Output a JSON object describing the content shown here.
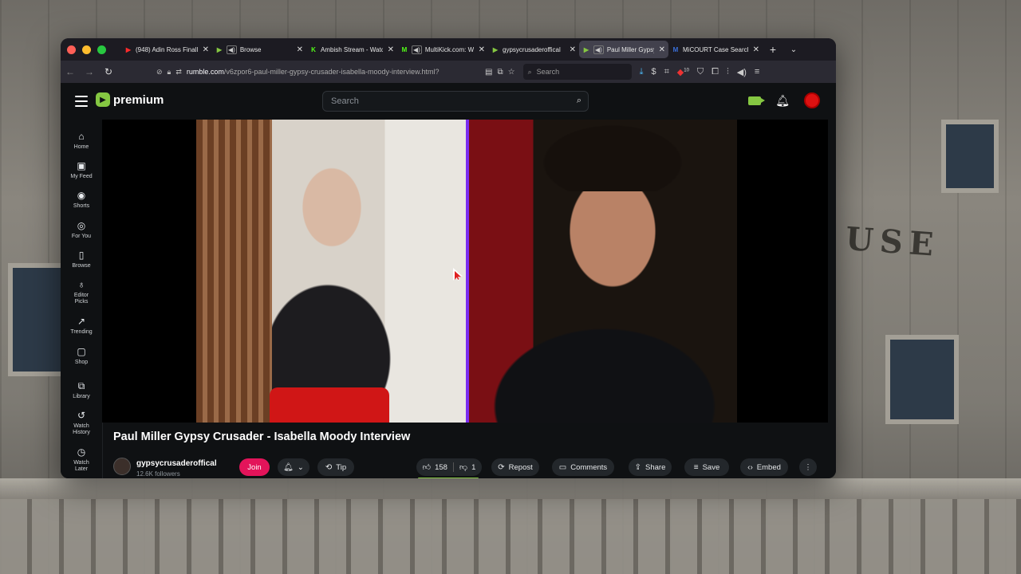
{
  "browser": {
    "tabs": [
      {
        "title": "(948) Adin Ross Finall",
        "favicon": "youtube-icon",
        "fav_color": "#ff0000",
        "active": false
      },
      {
        "title": "Browse",
        "favicon": "rumble-icon",
        "fav_color": "#85c742",
        "audio": true,
        "active": false
      },
      {
        "title": "Ambish Stream - Watc",
        "favicon": "kick-icon",
        "fav_color": "#53fc18",
        "active": false
      },
      {
        "title": "MultiKick.com: Wa",
        "favicon": "multikick-icon",
        "fav_color": "#53fc18",
        "audio": true,
        "active": false
      },
      {
        "title": "gypsycrusaderoffical",
        "favicon": "rumble-icon",
        "fav_color": "#85c742",
        "active": false
      },
      {
        "title": "Paul Miller Gypsy C",
        "favicon": "rumble-icon",
        "fav_color": "#85c742",
        "audio": true,
        "active": true
      },
      {
        "title": "MiCOURT Case Search",
        "favicon": "micourt-icon",
        "fav_color": "#3a6fd8",
        "active": false
      }
    ],
    "url_host": "rumble.com",
    "url_path": "/v6zpor6-paul-miller-gypsy-crusader-isabella-moody-interview.html?",
    "search_placeholder": "Search",
    "extension_badge": "10"
  },
  "header": {
    "logo_text": "premium",
    "search_placeholder": "Search"
  },
  "sidebar": {
    "items": [
      {
        "label": "Home",
        "icon": "home-icon"
      },
      {
        "label": "My Feed",
        "icon": "feed-icon"
      },
      {
        "label": "Shorts",
        "icon": "shorts-icon"
      },
      {
        "label": "For You",
        "icon": "target-icon"
      },
      {
        "label": "Browse",
        "icon": "browse-icon"
      },
      {
        "label": "Editor Picks",
        "icon": "award-icon"
      },
      {
        "label": "Trending",
        "icon": "trending-icon"
      },
      {
        "label": "Shop",
        "icon": "shop-icon"
      },
      {
        "label": "Library",
        "icon": "library-icon"
      },
      {
        "label": "Watch History",
        "icon": "history-icon"
      },
      {
        "label": "Watch Later",
        "icon": "clock-icon"
      }
    ]
  },
  "video": {
    "title": "Paul Miller Gypsy Crusader - Isabella Moody Interview",
    "channel_name": "gypsycrusaderoffical",
    "followers": "12.6K followers",
    "join_label": "Join",
    "tip_label": "Tip",
    "likes": "158",
    "dislikes": "1",
    "repost_label": "Repost",
    "comments_label": "Comments",
    "share_label": "Share",
    "save_label": "Save",
    "embed_label": "Embed"
  },
  "colors": {
    "rumble_green": "#85c742",
    "join_pink": "#e3145a",
    "divider_purple": "#7a2cf0"
  },
  "background_sign": "USE"
}
